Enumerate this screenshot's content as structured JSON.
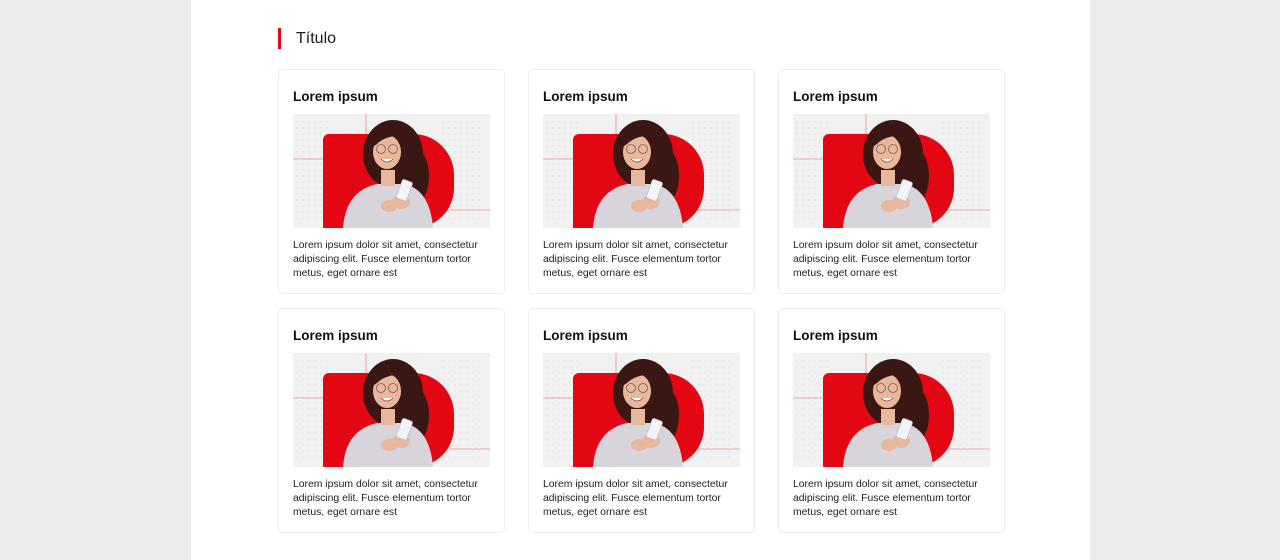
{
  "colors": {
    "accent": "#e30613",
    "image_bg": "#f1f1f1",
    "sweater": "#d8d4dc",
    "skin": "#e9b79b",
    "hair": "#3a1712"
  },
  "section": {
    "title": "Título"
  },
  "cards": [
    {
      "title": "Lorem ipsum",
      "image_icon": "woman-smartphone-photo",
      "description": "Lorem ipsum dolor sit amet, consectetur adipiscing elit. Fusce elementum tortor metus, eget ornare est"
    },
    {
      "title": "Lorem ipsum",
      "image_icon": "woman-smartphone-photo",
      "description": "Lorem ipsum dolor sit amet, consectetur adipiscing elit. Fusce elementum tortor metus, eget ornare est"
    },
    {
      "title": "Lorem ipsum",
      "image_icon": "woman-smartphone-photo",
      "description": "Lorem ipsum dolor sit amet, consectetur adipiscing elit. Fusce elementum tortor metus, eget ornare est"
    },
    {
      "title": "Lorem ipsum",
      "image_icon": "woman-smartphone-photo",
      "description": "Lorem ipsum dolor sit amet, consectetur adipiscing elit. Fusce elementum tortor metus, eget ornare est"
    },
    {
      "title": "Lorem ipsum",
      "image_icon": "woman-smartphone-photo",
      "description": "Lorem ipsum dolor sit amet, consectetur adipiscing elit. Fusce elementum tortor metus, eget ornare est"
    },
    {
      "title": "Lorem ipsum",
      "image_icon": "woman-smartphone-photo",
      "description": "Lorem ipsum dolor sit amet, consectetur adipiscing elit. Fusce elementum tortor metus, eget ornare est"
    }
  ]
}
